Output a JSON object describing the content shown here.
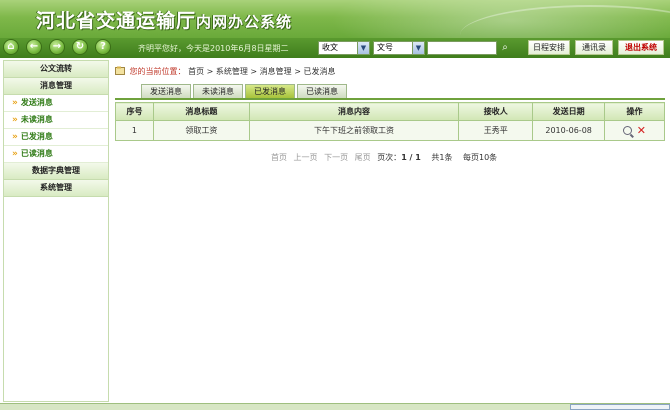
{
  "app": {
    "title_main": "河北省交通运输厅",
    "title_sub": "内网办公系统"
  },
  "toolbar": {
    "icons": [
      "home-icon",
      "back-icon",
      "forward-icon",
      "refresh-icon",
      "help-icon"
    ],
    "greeting": "齐明平您好，今天是2010年6月8日星期二",
    "select1": "收文",
    "select2": "文号",
    "search_value": "",
    "btn_schedule": "日程安排",
    "btn_contacts": "通讯录",
    "btn_exit": "退出系统"
  },
  "sidebar": {
    "sections": [
      {
        "label": "公文流转"
      },
      {
        "label": "消息管理"
      }
    ],
    "items": [
      {
        "label": "发送消息"
      },
      {
        "label": "未读消息"
      },
      {
        "label": "已发消息"
      },
      {
        "label": "已读消息"
      }
    ],
    "sections_bottom": [
      {
        "label": "数据字典管理"
      },
      {
        "label": "系统管理"
      }
    ]
  },
  "breadcrumb": {
    "lead": "您的当前位置：",
    "path": "首页 > 系统管理 > 消息管理 > 已发消息"
  },
  "tabs": [
    {
      "label": "发送消息"
    },
    {
      "label": "未读消息"
    },
    {
      "label": "已发消息",
      "active": true
    },
    {
      "label": "已读消息"
    }
  ],
  "table": {
    "headers": [
      "序号",
      "消息标题",
      "消息内容",
      "接收人",
      "发送日期",
      "操作"
    ],
    "rows": [
      {
        "no": "1",
        "title": "领取工资",
        "content": "下午下班之前领取工资",
        "receiver": "王秀平",
        "date": "2010-06-08"
      }
    ]
  },
  "pager": {
    "first": "首页",
    "prev": "上一页",
    "next": "下一页",
    "last": "尾页",
    "page_label": "页次：",
    "page_value": "1 / 1",
    "total": "共1条",
    "per_page": "每页10条"
  },
  "colors": {
    "header_green": "#7fb84a",
    "toolbar_green": "#3f7d1c",
    "active_tab": "#a7c33a",
    "exit_red": "#c00000"
  }
}
